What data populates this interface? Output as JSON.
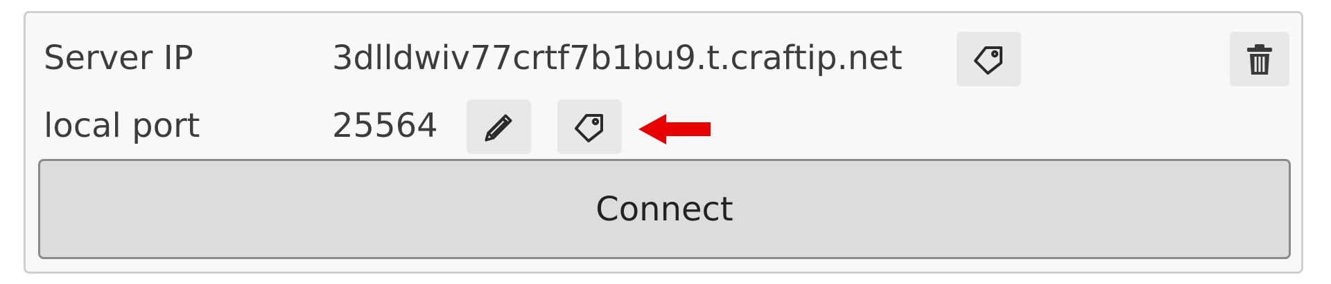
{
  "server_ip": {
    "label": "Server IP",
    "value": "3dlldwiv77crtf7b1bu9.t.craftip.net"
  },
  "local_port": {
    "label": "local port",
    "value": "25564"
  },
  "connect_button": {
    "label": "Connect"
  },
  "colors": {
    "annotation_arrow": "#e60000",
    "button_background": "#dcdcdc",
    "icon_button_background": "#e8e8e8"
  },
  "icons": {
    "copy_server_ip": "tag-icon",
    "delete_server": "trash-icon",
    "edit_port": "pencil-icon",
    "copy_port": "tag-icon"
  }
}
